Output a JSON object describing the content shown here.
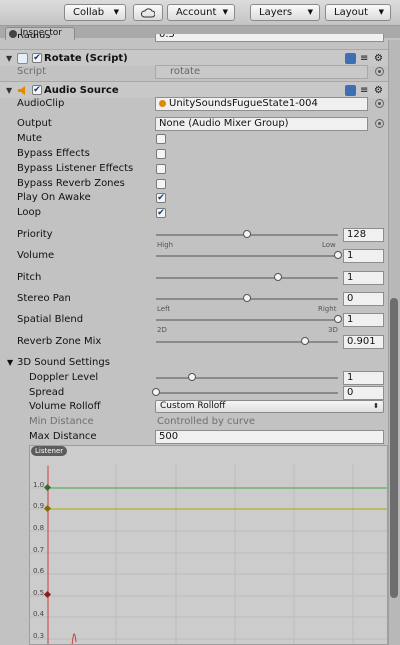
{
  "toolbar": {
    "collab": "Collab",
    "cloud_icon": "cloud-icon",
    "account": "Account",
    "layers": "Layers",
    "layout": "Layout"
  },
  "tab": {
    "label": "Inspector"
  },
  "partial_row": {
    "label": "Radius",
    "value": "0.5"
  },
  "rotate": {
    "title": "Rotate (Script)",
    "script_label": "Script",
    "script_value": "rotate"
  },
  "audio_source": {
    "title": "Audio Source",
    "audioclip_label": "AudioClip",
    "audioclip_value": "UnitySoundsFugueState1-004",
    "output_label": "Output",
    "output_value": "None (Audio Mixer Group)",
    "mute_label": "Mute",
    "bypass_effects_label": "Bypass Effects",
    "bypass_listener_label": "Bypass Listener Effects",
    "bypass_reverb_label": "Bypass Reverb Zones",
    "play_on_awake_label": "Play On Awake",
    "loop_label": "Loop",
    "toggles": {
      "mute": false,
      "bypass_effects": false,
      "bypass_listener": false,
      "bypass_reverb": false,
      "play_on_awake": true,
      "loop": true
    },
    "priority": {
      "label": "Priority",
      "value": "128",
      "level": 0.5,
      "min_cap": "High",
      "max_cap": "Low"
    },
    "volume": {
      "label": "Volume",
      "value": "1",
      "level": 1.0
    },
    "pitch": {
      "label": "Pitch",
      "value": "1",
      "level": 0.67
    },
    "stereo_pan": {
      "label": "Stereo Pan",
      "value": "0",
      "level": 0.5,
      "min_cap": "Left",
      "max_cap": "Right"
    },
    "spatial_blend": {
      "label": "Spatial Blend",
      "value": "1",
      "level": 1.0,
      "min_cap": "2D",
      "max_cap": "3D"
    },
    "reverb_zone_mix": {
      "label": "Reverb Zone Mix",
      "value": "0.901",
      "level": 0.82
    }
  },
  "sound3d": {
    "title": "3D Sound Settings",
    "doppler": {
      "label": "Doppler Level",
      "value": "1",
      "level": 0.2
    },
    "spread": {
      "label": "Spread",
      "value": "0",
      "level": 0.0
    },
    "rolloff_label": "Volume Rolloff",
    "rolloff_value": "Custom Rolloff",
    "min_distance_label": "Min Distance",
    "min_distance_value": "Controlled by curve",
    "max_distance_label": "Max Distance",
    "max_distance_value": "500"
  },
  "graph": {
    "legend": "Listener",
    "y_ticks": [
      "1.0",
      "0.9",
      "0.8",
      "0.7",
      "0.6",
      "0.5",
      "0.4",
      "0.3"
    ],
    "curve_colors": {
      "green": "#3fa63f",
      "yellow": "#b4a600",
      "red": "#d23c3c"
    }
  },
  "colors": {
    "accent_check": "#0a3a88",
    "header_bg": "#c8c8c8",
    "panel_bg": "#c2c2c2"
  }
}
